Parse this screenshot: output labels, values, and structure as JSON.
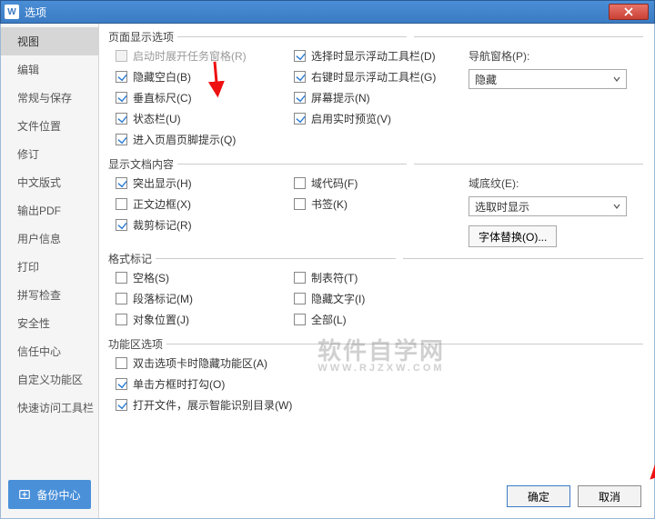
{
  "window": {
    "title": "选项"
  },
  "titlebar": {
    "close": "close"
  },
  "sidebar": {
    "items": [
      {
        "label": "视图",
        "selected": true
      },
      {
        "label": "编辑"
      },
      {
        "label": "常规与保存"
      },
      {
        "label": "文件位置"
      },
      {
        "label": "修订"
      },
      {
        "label": "中文版式"
      },
      {
        "label": "输出PDF"
      },
      {
        "label": "用户信息"
      },
      {
        "label": "打印"
      },
      {
        "label": "拼写检查"
      },
      {
        "label": "安全性"
      },
      {
        "label": "信任中心"
      },
      {
        "label": "自定义功能区"
      },
      {
        "label": "快速访问工具栏"
      }
    ],
    "backup": "备份中心"
  },
  "groups": {
    "pageDisplay": {
      "title": "页面显示选项",
      "col1": [
        {
          "label": "启动时展开任务窗格(R)",
          "checked": false,
          "disabled": true
        },
        {
          "label": "隐藏空白(B)",
          "checked": true
        },
        {
          "label": "垂直标尺(C)",
          "checked": true
        },
        {
          "label": "状态栏(U)",
          "checked": true
        },
        {
          "label": "进入页眉页脚提示(Q)",
          "checked": true
        }
      ],
      "col2": [
        {
          "label": "选择时显示浮动工具栏(D)",
          "checked": true
        },
        {
          "label": "右键时显示浮动工具栏(G)",
          "checked": true
        },
        {
          "label": "屏幕提示(N)",
          "checked": true
        },
        {
          "label": "启用实时预览(V)",
          "checked": true
        }
      ],
      "navLabel": "导航窗格(P):",
      "navValue": "隐藏"
    },
    "docContent": {
      "title": "显示文档内容",
      "col1": [
        {
          "label": "突出显示(H)",
          "checked": true
        },
        {
          "label": "正文边框(X)",
          "checked": false
        },
        {
          "label": "裁剪标记(R)",
          "checked": true
        }
      ],
      "col2": [
        {
          "label": "域代码(F)",
          "checked": false
        },
        {
          "label": "书签(K)",
          "checked": false
        }
      ],
      "shadeLabel": "域底纹(E):",
      "shadeValue": "选取时显示",
      "fontBtn": "字体替换(O)..."
    },
    "marks": {
      "title": "格式标记",
      "col1": [
        {
          "label": "空格(S)",
          "checked": false
        },
        {
          "label": "段落标记(M)",
          "checked": false
        },
        {
          "label": "对象位置(J)",
          "checked": false
        }
      ],
      "col2": [
        {
          "label": "制表符(T)",
          "checked": false
        },
        {
          "label": "隐藏文字(I)",
          "checked": false
        },
        {
          "label": "全部(L)",
          "checked": false
        }
      ]
    },
    "ribbon": {
      "title": "功能区选项",
      "items": [
        {
          "label": "双击选项卡时隐藏功能区(A)",
          "checked": false
        },
        {
          "label": "单击方框时打勾(O)",
          "checked": true
        },
        {
          "label": "打开文件，展示智能识别目录(W)",
          "checked": true
        }
      ]
    }
  },
  "footer": {
    "ok": "确定",
    "cancel": "取消"
  },
  "watermark": {
    "main": "软件自学网",
    "sub": "WWW.RJZXW.COM"
  }
}
